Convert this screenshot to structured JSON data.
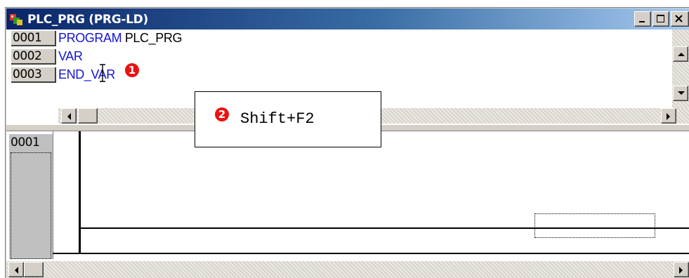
{
  "window": {
    "title": "PLC_PRG (PRG-LD)"
  },
  "caption_buttons": [
    "minimize",
    "maximize",
    "close"
  ],
  "declaration": {
    "lines": [
      {
        "num": "0001",
        "keyword": "PROGRAM",
        "identifier": " PLC_PRG"
      },
      {
        "num": "0002",
        "keyword": "VAR",
        "identifier": ""
      },
      {
        "num": "0003",
        "keyword": "END_VAR",
        "identifier": ""
      }
    ]
  },
  "ladder": {
    "network_number": "0001"
  },
  "annotations": {
    "marker1": "1",
    "marker2": "2",
    "callout_text": "Shift+F2"
  },
  "colors": {
    "keyword": "#1414d4",
    "titlebar_start": "#0a246a",
    "titlebar_end": "#a6caf0",
    "marker": "#ee1111"
  },
  "icons": [
    "plc-program-icon",
    "minimize-icon",
    "maximize-icon",
    "close-icon",
    "arrow-up-icon",
    "arrow-down-icon",
    "arrow-left-icon",
    "arrow-right-icon",
    "text-cursor-icon"
  ]
}
